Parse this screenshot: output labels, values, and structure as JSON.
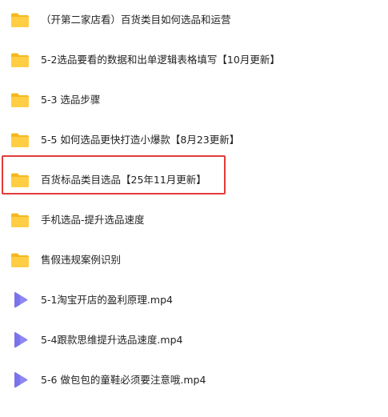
{
  "items": [
    {
      "type": "folder",
      "name": "（开第二家店看）百货类目如何选品和运营"
    },
    {
      "type": "folder",
      "name": "5-2选品要看的数据和出单逻辑表格填写【10月更新】"
    },
    {
      "type": "folder",
      "name": "5-3 选品步骤"
    },
    {
      "type": "folder",
      "name": "5-5 如何选品更快打造小爆款【8月23更新】"
    },
    {
      "type": "folder",
      "name": "百货标品类目选品【25年11月更新】",
      "highlighted": true
    },
    {
      "type": "folder",
      "name": "手机选品-提升选品速度"
    },
    {
      "type": "folder",
      "name": "售假违规案例识别"
    },
    {
      "type": "video",
      "name": "5-1淘宝开店的盈利原理.mp4"
    },
    {
      "type": "video",
      "name": "5-4跟款思维提升选品速度.mp4"
    },
    {
      "type": "video",
      "name": "5-6 做包包的童鞋必须要注意哦.mp4"
    }
  ],
  "colors": {
    "folder_back": "#f7b81f",
    "folder_front": "#ffce45",
    "video_icon": "#8d87f2",
    "highlight_border": "#e23b3b"
  },
  "icons": {
    "folder": "folder-icon",
    "video": "video-file-icon"
  }
}
